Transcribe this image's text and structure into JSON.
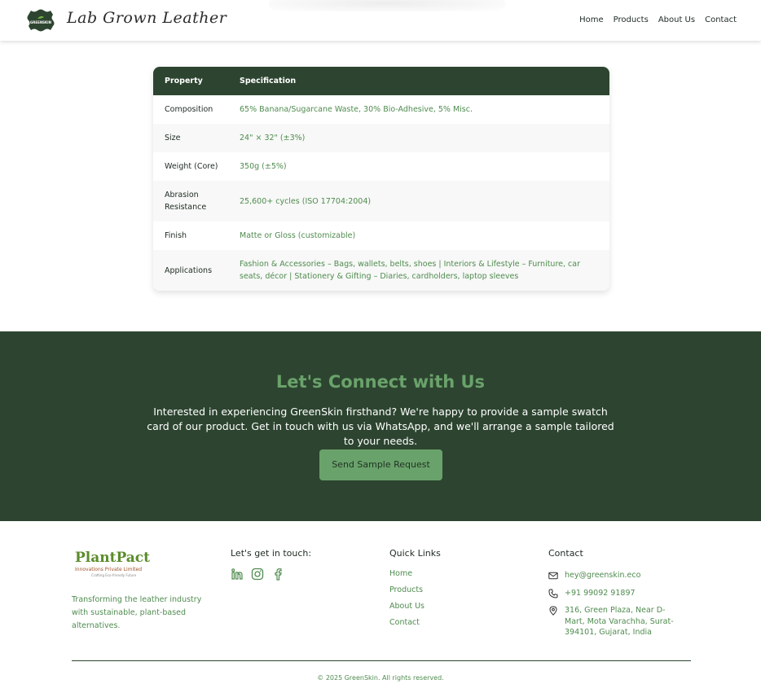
{
  "header": {
    "brand": "Lab Grown Leather",
    "logo_text": "GREENSKIN",
    "nav": [
      "Home",
      "Products",
      "About Us",
      "Contact"
    ]
  },
  "spec_table": {
    "headers": [
      "Property",
      "Specification"
    ],
    "rows": [
      {
        "property": "Composition",
        "spec": "65% Banana/Sugarcane Waste, 30% Bio-Adhesive, 5% Misc."
      },
      {
        "property": "Size",
        "spec": "24\" × 32\" (±3%)"
      },
      {
        "property": "Weight (Core)",
        "spec": "350g (±5%)"
      },
      {
        "property": "Abrasion Resistance",
        "spec": "25,600+ cycles (ISO 17704:2004)"
      },
      {
        "property": "Finish",
        "spec": "Matte or Gloss (customizable)"
      },
      {
        "property": "Applications",
        "spec": "Fashion & Accessories – Bags, wallets, belts, shoes | Interiors & Lifestyle – Furniture, car seats, décor | Stationery & Gifting – Diaries, cardholders, laptop sleeves"
      }
    ]
  },
  "connect": {
    "title": "Let's Connect with Us",
    "body": "Interested in experiencing GreenSkin firsthand? We're happy to provide a sample swatch card of our product. Get in touch with us via WhatsApp, and we'll arrange a sample tailored to your needs.",
    "button": "Send Sample Request"
  },
  "footer": {
    "logo_name": "PlantPact",
    "logo_sub": "Innovations Private Limited",
    "logo_tag": "Crafting Eco-friendly Future",
    "description": "Transforming the leather industry with sustainable, plant-based alternatives.",
    "touch_title": "Let's get in touch:",
    "social": [
      "linkedin-icon",
      "instagram-icon",
      "facebook-icon"
    ],
    "quick_links_title": "Quick Links",
    "quick_links": [
      "Home",
      "Products",
      "About Us",
      "Contact"
    ],
    "contact_title": "Contact",
    "email": "hey@greenskin.eco",
    "phone": "+91 99092 91897",
    "address": "316, Green Plaza, Near D-Mart, Mota Varachha, Surat-394101, Gujarat, India",
    "copyright": "© 2025 GreenSkin. All rights reserved."
  },
  "colors": {
    "dark_green": "#2d4530",
    "accent_green": "#6aa26b",
    "text_green": "#4f8b4f"
  }
}
